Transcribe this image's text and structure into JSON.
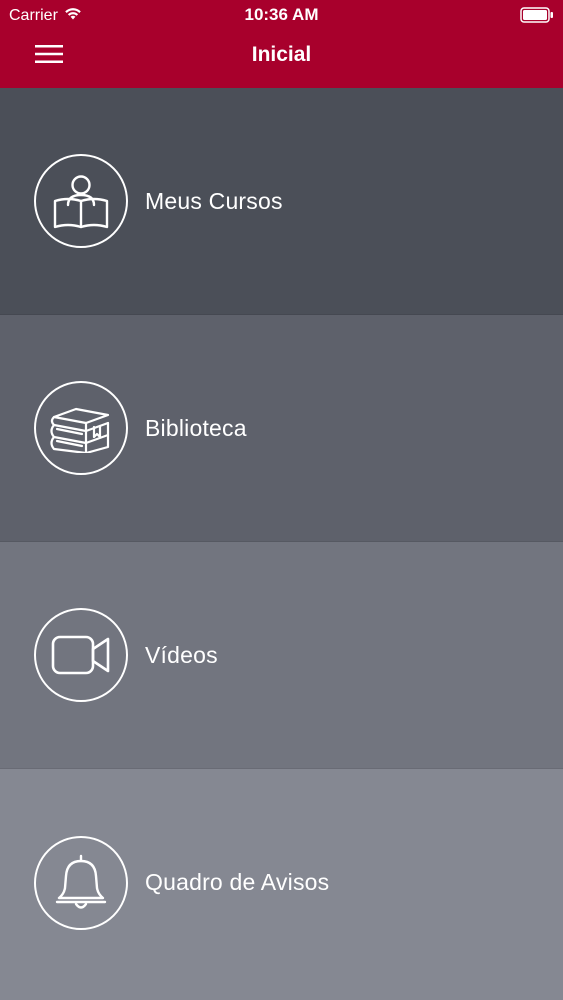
{
  "status_bar": {
    "carrier": "Carrier",
    "time": "10:36 AM"
  },
  "nav": {
    "title": "Inicial"
  },
  "menu": {
    "items": [
      {
        "label": "Meus Cursos",
        "icon": "student-reading-icon",
        "bg": "#4b4f58"
      },
      {
        "label": "Biblioteca",
        "icon": "books-icon",
        "bg": "#5e616b"
      },
      {
        "label": "Vídeos",
        "icon": "video-camera-icon",
        "bg": "#72757f"
      },
      {
        "label": "Quadro de Avisos",
        "icon": "bell-icon",
        "bg": "#858892"
      }
    ]
  },
  "colors": {
    "header": "#a8002c",
    "text": "#ffffff"
  }
}
